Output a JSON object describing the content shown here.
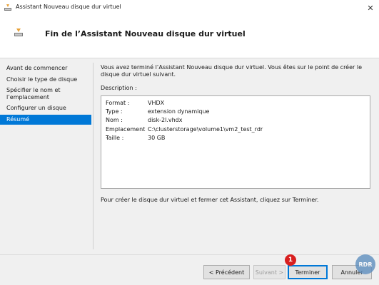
{
  "window": {
    "title": "Assistant Nouveau disque dur virtuel",
    "close_glyph": "✕"
  },
  "header": {
    "title": "Fin de l’Assistant Nouveau disque dur virtuel"
  },
  "nav": {
    "items": [
      {
        "label": "Avant de commencer"
      },
      {
        "label": "Choisir le type de disque"
      },
      {
        "label": "Spécifier le nom et l’emplacement"
      },
      {
        "label": "Configurer un disque"
      },
      {
        "label": "Résumé",
        "selected": true
      }
    ]
  },
  "content": {
    "intro": "Vous avez terminé l’Assistant Nouveau disque dur virtuel. Vous êtes sur le point de créer le disque dur virtuel suivant.",
    "description_label": "Description :",
    "description": [
      {
        "key": "Format :",
        "value": "VHDX"
      },
      {
        "key": "Type :",
        "value": "extension dynamique"
      },
      {
        "key": "Nom :",
        "value": "disk-2l.vhdx"
      },
      {
        "key": "Emplacement :",
        "value": "C:\\clusterstorage\\volume1\\vm2_test_rdr"
      },
      {
        "key": "Taille :",
        "value": "30 GB"
      }
    ],
    "finish_text": "Pour créer le disque dur virtuel et fermer cet Assistant, cliquez sur Terminer."
  },
  "buttons": {
    "previous": "< Précédent",
    "next": "Suivant >",
    "finish": "Terminer",
    "cancel": "Annuler"
  },
  "annotation_badge": "1",
  "watermark": "RDR",
  "colors": {
    "selection": "#0078d7",
    "badge": "#d81f1f"
  }
}
